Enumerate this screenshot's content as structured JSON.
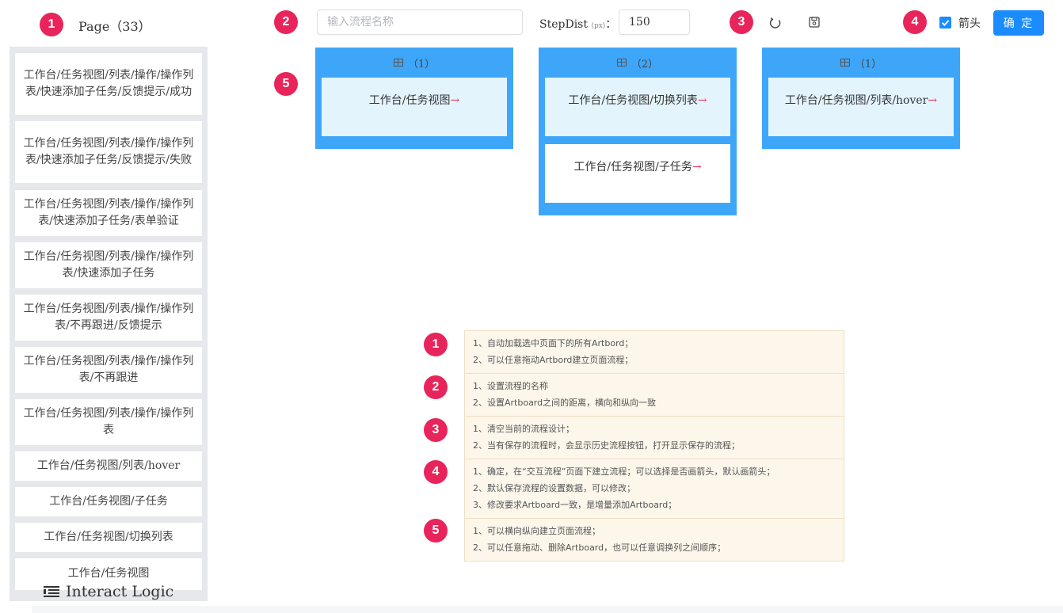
{
  "sidebar": {
    "title": "Page（33）",
    "items": [
      "工作台/任务视图/列表/操作/操作列表/快速添加子任务/反馈提示/成功",
      "工作台/任务视图/列表/操作/操作列表/快速添加子任务/反馈提示/失败",
      "工作台/任务视图/列表/操作/操作列表/快速添加子任务/表单验证",
      "工作台/任务视图/列表/操作/操作列表/快速添加子任务",
      "工作台/任务视图/列表/操作/操作列表/不再跟进/反馈提示",
      "工作台/任务视图/列表/操作/操作列表/不再跟进",
      "工作台/任务视图/列表/操作/操作列表",
      "工作台/任务视图/列表/hover",
      "工作台/任务视图/子任务",
      "工作台/任务视图/切换列表",
      "工作台/任务视图"
    ],
    "logo_text": "Interact Logic"
  },
  "toolbar": {
    "flow_name_placeholder": "输入流程名称",
    "flow_name_value": "",
    "step_label": "StepDist",
    "step_unit": "(px)",
    "step_colon": "：",
    "step_value": "150",
    "arrow_label": "箭头",
    "arrow_checked": true,
    "confirm_label": "确 定",
    "icons": [
      "refresh-icon",
      "save-icon",
      "checkbox-icon"
    ]
  },
  "badges": [
    "1",
    "2",
    "3",
    "4",
    "5"
  ],
  "columns": [
    {
      "header": "（1）",
      "cards": [
        {
          "text": "工作台/任务视图",
          "arrow": "→"
        }
      ]
    },
    {
      "header": "（2）",
      "cards": [
        {
          "text": "工作台/任务视图/切换列表",
          "arrow": "→"
        },
        {
          "text": "工作台/任务视图/子任务",
          "arrow": "→"
        }
      ]
    },
    {
      "header": "（1）",
      "cards": [
        {
          "text": "工作台/任务视图/列表/hover",
          "arrow": "→"
        }
      ]
    }
  ],
  "notes": [
    {
      "num": "1",
      "lines": [
        "1、自动加载选中页面下的所有Artbord；",
        "2、可以任意拖动Artbord建立页面流程；"
      ]
    },
    {
      "num": "2",
      "lines": [
        "1、设置流程的名称",
        "2、设置Artboard之间的距离，横向和纵向一致"
      ]
    },
    {
      "num": "3",
      "lines": [
        "1、清空当前的流程设计；",
        "2、当有保存的流程时，会显示历史流程按钮，打开显示保存的流程；"
      ]
    },
    {
      "num": "4",
      "lines": [
        "1、确定，在“交互流程”页面下建立流程；可以选择是否画箭头，默认画箭头；",
        "2、默认保存流程的设置数据，可以修改；",
        "3、修改要求Artboard一致，是增量添加Artboard；"
      ]
    },
    {
      "num": "5",
      "lines": [
        "1、可以横向纵向建立页面流程；",
        "2、可以任意拖动、删除Artboard，也可以任意调换列之间顺序；"
      ]
    }
  ],
  "colors": {
    "badge": "#e8245a",
    "column": "#3ea6f9",
    "accent": "#1a8cff",
    "arrow": "#ec3a5c",
    "note_bg": "#fdf6eb"
  }
}
